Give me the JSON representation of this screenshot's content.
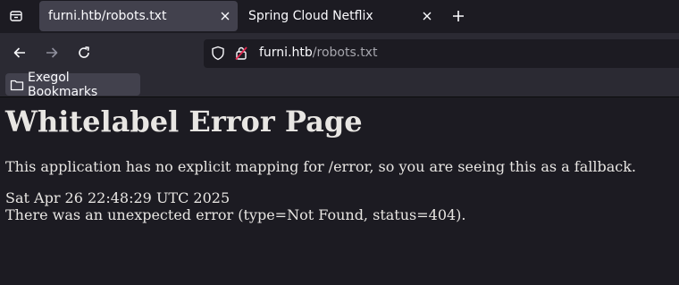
{
  "tabs": [
    {
      "title": "furni.htb/robots.txt",
      "active": true
    },
    {
      "title": "Spring Cloud Netflix",
      "active": false
    }
  ],
  "icons": {
    "tab_list": "tab-list-icon",
    "close": "close-icon",
    "new_tab": "plus-icon",
    "back": "back-arrow-icon",
    "forward": "forward-arrow-icon",
    "reload": "reload-icon",
    "shield": "shield-icon",
    "lock": "lock-icon",
    "folder": "folder-icon"
  },
  "urlbar": {
    "host": "furni.htb",
    "path": "/robots.txt"
  },
  "bookmarks": {
    "items": [
      {
        "label": "Exegol Bookmarks"
      }
    ]
  },
  "page": {
    "heading": "Whitelabel Error Page",
    "message": "This application has no explicit mapping for /error, so you are seeing this as a fallback.",
    "timestamp": "Sat Apr 26 22:48:29 UTC 2025",
    "error": "There was an unexpected error (type=Not Found, status=404)."
  }
}
